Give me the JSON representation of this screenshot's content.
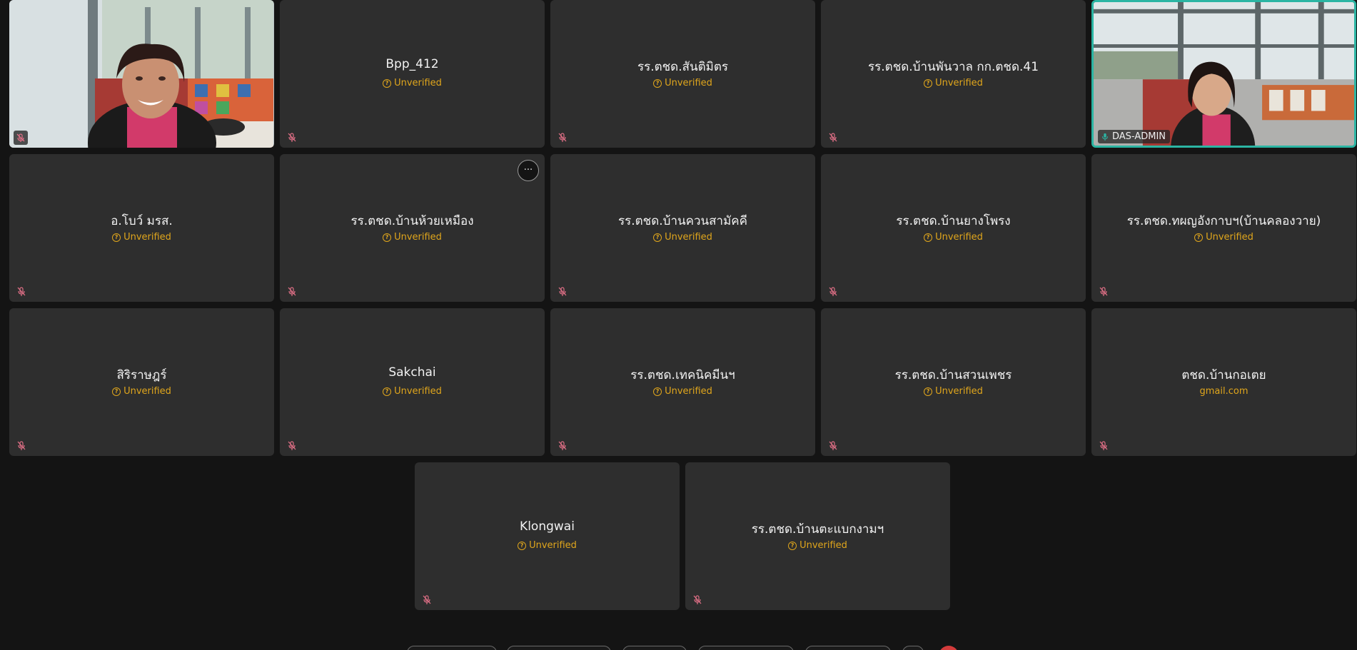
{
  "meeting": {
    "tiles": [
      {
        "name": "",
        "subtitle": "",
        "video": true
      },
      {
        "name": "Bpp_412",
        "subtitle": "Unverified"
      },
      {
        "name": "รร.ตชด.สันติมิตร",
        "subtitle": "Unverified"
      },
      {
        "name": "รร.ตชด.บ้านพันวาล กก.ตชด.41",
        "subtitle": "Unverified"
      },
      {
        "name": "DAS-ADMIN",
        "subtitle": "",
        "video": true,
        "active": true
      },
      {
        "name": "อ.โบว์ มรส.",
        "subtitle": "Unverified"
      },
      {
        "name": "รร.ตชด.บ้านห้วยเหมือง",
        "subtitle": "Unverified",
        "more_button": "···"
      },
      {
        "name": "รร.ตชด.บ้านควนสามัคคี",
        "subtitle": "Unverified"
      },
      {
        "name": "รร.ตชด.บ้านยางโพรง",
        "subtitle": "Unverified"
      },
      {
        "name": "รร.ตชด.ทผญอังกาบฯ(บ้านคลองวาย)",
        "subtitle": "Unverified"
      },
      {
        "name": "สิริราษฎร์",
        "subtitle": "Unverified"
      },
      {
        "name": "Sakchai",
        "subtitle": "Unverified"
      },
      {
        "name": "รร.ตชด.เทคนิคมีนฯ",
        "subtitle": "Unverified"
      },
      {
        "name": "รร.ตชด.บ้านสวนเพชร",
        "subtitle": "Unverified"
      },
      {
        "name": "ตชด.บ้านกอเตย",
        "subtitle": "gmail.com",
        "subtitle_plain": true
      },
      {
        "name": "Klongwai",
        "subtitle": "Unverified"
      },
      {
        "name": "รร.ตชด.บ้านตะแบกงามฯ",
        "subtitle": "Unverified"
      }
    ]
  },
  "colors": {
    "background": "#141414",
    "tile": "#2e2e2e",
    "unverified": "#e0a61c",
    "active_border": "#2bb5a3",
    "muted_mic": "#e06f86"
  },
  "icons": {
    "mic_muted": "mic-muted-icon",
    "mic_on": "mic-icon",
    "info": "info-circle-icon"
  }
}
